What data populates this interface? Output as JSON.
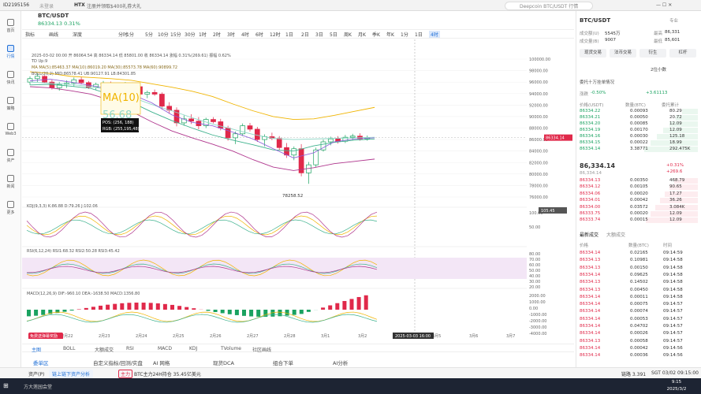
{
  "titlebar": {
    "id": "ID2195156",
    "status": "未登录",
    "site": "HTX",
    "promo": "注册并领取$400礼券大礼",
    "search": "Deepcoin BTC/USDT 行情"
  },
  "nav": [
    "首页",
    "行情",
    "快讯",
    "策略",
    "Web3",
    "资产",
    "新闻",
    "更多"
  ],
  "symbol": {
    "pair": "BTC/USDT",
    "price": "86334.13",
    "change": "0.31%",
    "tab_kline": "指标",
    "tab_depth": "画线",
    "tab_chart": "深度"
  },
  "timeframes": [
    "分时",
    "1分",
    "5分",
    "10分",
    "15分",
    "30分",
    "1时",
    "2时",
    "3时",
    "4时",
    "6时",
    "12时",
    "1日",
    "2日",
    "3日",
    "5日",
    "周K",
    "月K",
    "季K",
    "年K",
    "1分",
    "1日",
    "4时"
  ],
  "chart_info": {
    "date": "2025-03-02 00:00",
    "o": "开 86064.54",
    "h": "高 86334.14",
    "l": "低 85801.00",
    "c": "收 86334.14",
    "chg": "涨幅 0.31%(269.61)",
    "amp": "振幅 0.62%",
    "td": "TD",
    "up": "Up:9",
    "ma": "MA",
    "ma5": "MA(5):85463.37",
    "ma10": "MA(10):86019.20",
    "ma30": "MA(30):85573.78",
    "ma60": "MA(60):90899.72",
    "boll": "BOLL(20,2)",
    "boll_v": "MID:86578.41  UB:90127.91  LB:84301.85",
    "big": "MA(10)",
    "bigval": "56.68",
    "pos": "POS: (256, 188)",
    "rgb": "RGB: (255,195,48)",
    "lowlabel": "78258.52",
    "kdj": "KDJ(9,3,3)  K:86.88  D:79.26  J:102.06",
    "rsi": "RSI(6,12,24)  RSI1:68.32  RSI2:50.28  RSI3:45.42",
    "macd": "MACD(12,26,9)  DIF:-960.10  DEA:-1638.50  MACD:1356.80",
    "promo": "免费送弹幕奖励"
  },
  "price_axis": [
    "100000.00",
    "98000.00",
    "96000.00",
    "94000.00",
    "92000.00",
    "90000.00",
    "88000.00",
    "86000.00",
    "84000.00",
    "82000.00",
    "80000.00",
    "78000.00",
    "76000.00"
  ],
  "last_price": "86334.14",
  "kdj_axis": [
    "100.00",
    "50.00"
  ],
  "kdj_val": "105.45",
  "rsi_axis": [
    "80.00",
    "70.00",
    "60.00",
    "50.00",
    "40.00",
    "30.00",
    "20.00"
  ],
  "macd_axis": [
    "2000.00",
    "1000.00",
    "0.00",
    "-1000.00",
    "-2000.00",
    "-3000.00",
    "-4000.00"
  ],
  "dates": [
    "2月22",
    "2月23",
    "2月24",
    "2月25",
    "2月26",
    "2月27",
    "2月28",
    "3月1",
    "3月2",
    "3月3",
    "3月5",
    "3月6",
    "3月7"
  ],
  "crosshair": "2025-03-03 16:00",
  "indicator_tabs": [
    "主图",
    "BOLL",
    "大额成交",
    "RSI",
    "MACD",
    "KDJ",
    "TVolume",
    "社区画线"
  ],
  "bottom_tabs": [
    "委单区",
    "自定义指标/回测/实盘",
    "AI 网格",
    "现货DCA",
    "组合下单",
    "AI分析"
  ],
  "status": {
    "assets": "资产(P)",
    "link": "链上链下资产分析",
    "mainforce": "主力",
    "flow": "BTC主力24H持仓 35.45亿美元",
    "conn": "链路 3.391",
    "time": "SGT 03/02 09:15:00"
  },
  "taskbar": {
    "app": "方大莲园会堂",
    "time": "9:15",
    "date": "2025/3/2"
  },
  "right": {
    "pair": "BTC/USDT",
    "pair_sub": "专业",
    "turnover_l": "成交额(U)",
    "turnover": "5545万",
    "high_l": "最高",
    "high": "86,331",
    "vol_l": "成交量(B)",
    "vol": "9007",
    "low_l": "最低",
    "low": "85,601",
    "btns": [
      "现货交易",
      "法币交易",
      "衍生",
      "杠杆"
    ],
    "depth_sel": "2位小数",
    "bench": "委托十万挂单情况",
    "pct_l": "涨跌",
    "pct": "-0.50%",
    "pct2": "+3.61113",
    "hdr": [
      "价格(USDT)",
      "数量(BTC)",
      "委托累计"
    ],
    "asks": [
      [
        "86334.22",
        "0.00093",
        "80.29"
      ],
      [
        "86334.21",
        "0.00050",
        "20.72"
      ],
      [
        "86334.20",
        "0.00085",
        "12.09"
      ],
      [
        "86334.19",
        "0.00170",
        "12.09"
      ],
      [
        "86334.16",
        "0.00030",
        "125.18"
      ],
      [
        "86334.15",
        "0.00022",
        "18.99"
      ],
      [
        "86334.14",
        "3.38771",
        "292.475K"
      ]
    ],
    "mid_price": "86,334.14",
    "mid_sub": "86,334.14",
    "mid_pct": "+0.31%",
    "mid_chg": "+269.6",
    "bids": [
      [
        "86334.13",
        "0.00350",
        "468.79"
      ],
      [
        "86334.12",
        "0.00105",
        "90.65"
      ],
      [
        "86334.06",
        "0.00020",
        "17.27"
      ],
      [
        "86334.01",
        "0.00042",
        "36.26"
      ],
      [
        "86334.00",
        "0.03572",
        "3.084K"
      ],
      [
        "86333.75",
        "0.00020",
        "12.09"
      ],
      [
        "86333.74",
        "0.00015",
        "12.09"
      ]
    ],
    "trades_tab": "最新成交",
    "trades_tab2": "大额成交",
    "trades_hdr": [
      "价格",
      "数量(BTC)",
      "时间"
    ],
    "trades": [
      [
        "86334.14",
        "0.02165",
        "09:14:59"
      ],
      [
        "86334.13",
        "0.10981",
        "09:14:58"
      ],
      [
        "86334.13",
        "0.00150",
        "09:14:58"
      ],
      [
        "86334.14",
        "0.09625",
        "09:14:58"
      ],
      [
        "86334.13",
        "0.14502",
        "09:14:58"
      ],
      [
        "86334.13",
        "0.00450",
        "09:14:58"
      ],
      [
        "86334.14",
        "0.00011",
        "09:14:58"
      ],
      [
        "86334.14",
        "0.00075",
        "09:14:57"
      ],
      [
        "86334.14",
        "0.00074",
        "09:14:57"
      ],
      [
        "86334.14",
        "0.00053",
        "09:14:57"
      ],
      [
        "86334.14",
        "0.04702",
        "09:14:57"
      ],
      [
        "86334.14",
        "0.00026",
        "09:14:57"
      ],
      [
        "86334.13",
        "0.00058",
        "09:14:57"
      ],
      [
        "86334.14",
        "0.00042",
        "09:14:56"
      ],
      [
        "86334.14",
        "0.00036",
        "09:14:56"
      ]
    ]
  },
  "colors": {
    "up": "#1aa260",
    "down": "#e0294a",
    "accent": "#1f6fd6"
  }
}
